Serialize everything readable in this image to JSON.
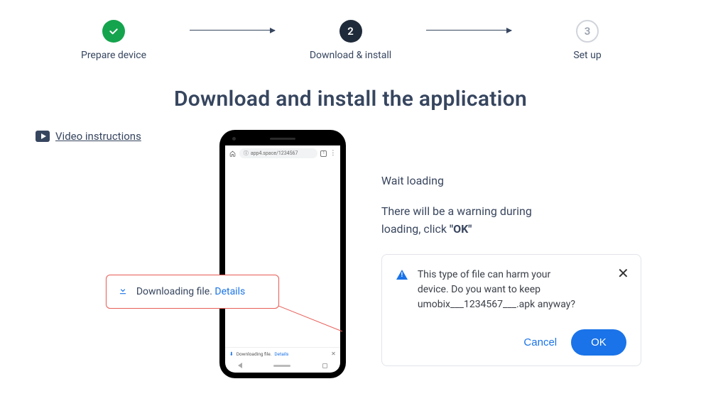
{
  "stepper": {
    "step1": {
      "label": "Prepare device"
    },
    "step2": {
      "number": "2",
      "label": "Download & install"
    },
    "step3": {
      "number": "3",
      "label": "Set up"
    }
  },
  "title": "Download and install the application",
  "video_link": "Video instructions",
  "phone": {
    "url": "app4.space/1234567",
    "download_text": "Downloading file.",
    "download_details": "Details",
    "tab_count": "1"
  },
  "callout": {
    "text": "Downloading file.",
    "details": "Details"
  },
  "right": {
    "wait": "Wait loading",
    "warning_pre": "There will be a warning during loading, click ",
    "warning_bold": "\"OK\""
  },
  "dialog": {
    "text": "This type of file can harm your device. Do you want to keep umobix___1234567___.apk anyway?",
    "cancel": "Cancel",
    "ok": "OK"
  }
}
